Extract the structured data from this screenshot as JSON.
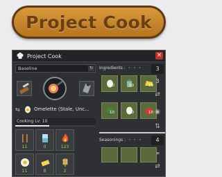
{
  "banner": {
    "title": "Project Cook"
  },
  "window": {
    "title": "Project Cook",
    "close_label": "×",
    "icons": {
      "chef": "chef-hat-icon",
      "close": "close-icon"
    }
  },
  "left": {
    "dropdown": {
      "value": "Baseline",
      "arrow": "↻"
    },
    "tools": [
      "knife-board-icon",
      "frying-pan-icon",
      "grater-icon"
    ],
    "recipe": {
      "name": "Omelette (Stale, Unc...",
      "prev_next": "⇆"
    },
    "cooking_level": {
      "label": "Cooking Lv: 10",
      "progress": 0.42
    },
    "stats": [
      {
        "icon": "utensils-icon",
        "value": "11"
      },
      {
        "icon": "glass-icon",
        "value": "0"
      },
      {
        "icon": "fire-icon",
        "value": "123"
      },
      {
        "icon": "egg-icon",
        "value": "11"
      },
      {
        "icon": "butter-icon",
        "value": "8"
      },
      {
        "icon": "wheat-icon",
        "value": "2"
      }
    ]
  },
  "ingredients": {
    "label": "Ingredients :",
    "dots": "• • •",
    "slots": [
      {
        "icon": "egg-icon",
        "qty": "10"
      },
      {
        "icon": "bottle-icon",
        "qty": "10"
      },
      {
        "icon": "cheese-icon",
        "qty": "10"
      },
      {
        "icon": "herb-icon",
        "qty": "10"
      },
      {
        "icon": "egg-icon",
        "qty": "10"
      },
      {
        "icon": "tomato-icon",
        "qty": "10"
      }
    ],
    "counts": [
      "3",
      "3"
    ],
    "side_icons": [
      "shuffle-icon",
      "eye-icon",
      "sort-icon"
    ]
  },
  "seasonings": {
    "label": "Seasonings :",
    "dots": "• • •",
    "counts": [
      "4",
      "∞"
    ],
    "side_icons": [
      "shuffle-icon"
    ]
  },
  "colors": {
    "banner": "#c88530",
    "window_bg": "#2f3033",
    "slot_green": "#5b6a3d",
    "value_green": "#8fdc5a",
    "close_red": "#b8332e"
  }
}
